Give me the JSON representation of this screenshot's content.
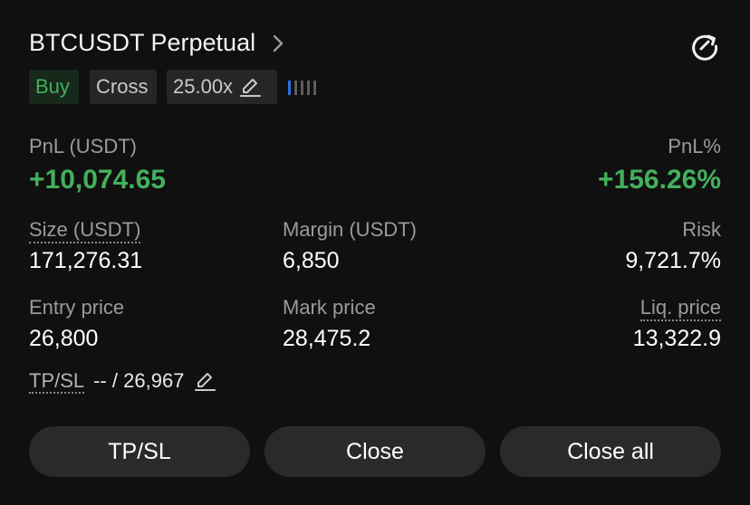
{
  "header": {
    "title": "BTCUSDT Perpetual",
    "chevron_icon": "chevron-right-icon",
    "share_icon": "share-refresh-icon"
  },
  "tags": {
    "side": "Buy",
    "margin_mode": "Cross",
    "leverage": "25.00x",
    "edit_icon": "pencil-icon"
  },
  "risk_level": {
    "filled_bars": 1,
    "total_bars": 5
  },
  "pnl": {
    "label": "PnL (USDT)",
    "value": "+10,074.65",
    "pct_label": "PnL%",
    "pct_value": "+156.26%"
  },
  "stats_row1": {
    "size_label": "Size (USDT)",
    "size_value": "171,276.31",
    "margin_label": "Margin (USDT)",
    "margin_value": "6,850",
    "risk_label": "Risk",
    "risk_value": "9,721.7%"
  },
  "stats_row2": {
    "entry_label": "Entry price",
    "entry_value": "26,800",
    "mark_label": "Mark price",
    "mark_value": "28,475.2",
    "liq_label": "Liq. price",
    "liq_value": "13,322.9"
  },
  "tpsl": {
    "label": "TP/SL",
    "value": "-- / 26,967"
  },
  "buttons": {
    "tpsl": "TP/SL",
    "close": "Close",
    "close_all": "Close all"
  },
  "colors": {
    "profit": "#43b05c",
    "background": "#101010",
    "button": "#2a2a2a",
    "risk_bar": "#2f6fe0"
  }
}
